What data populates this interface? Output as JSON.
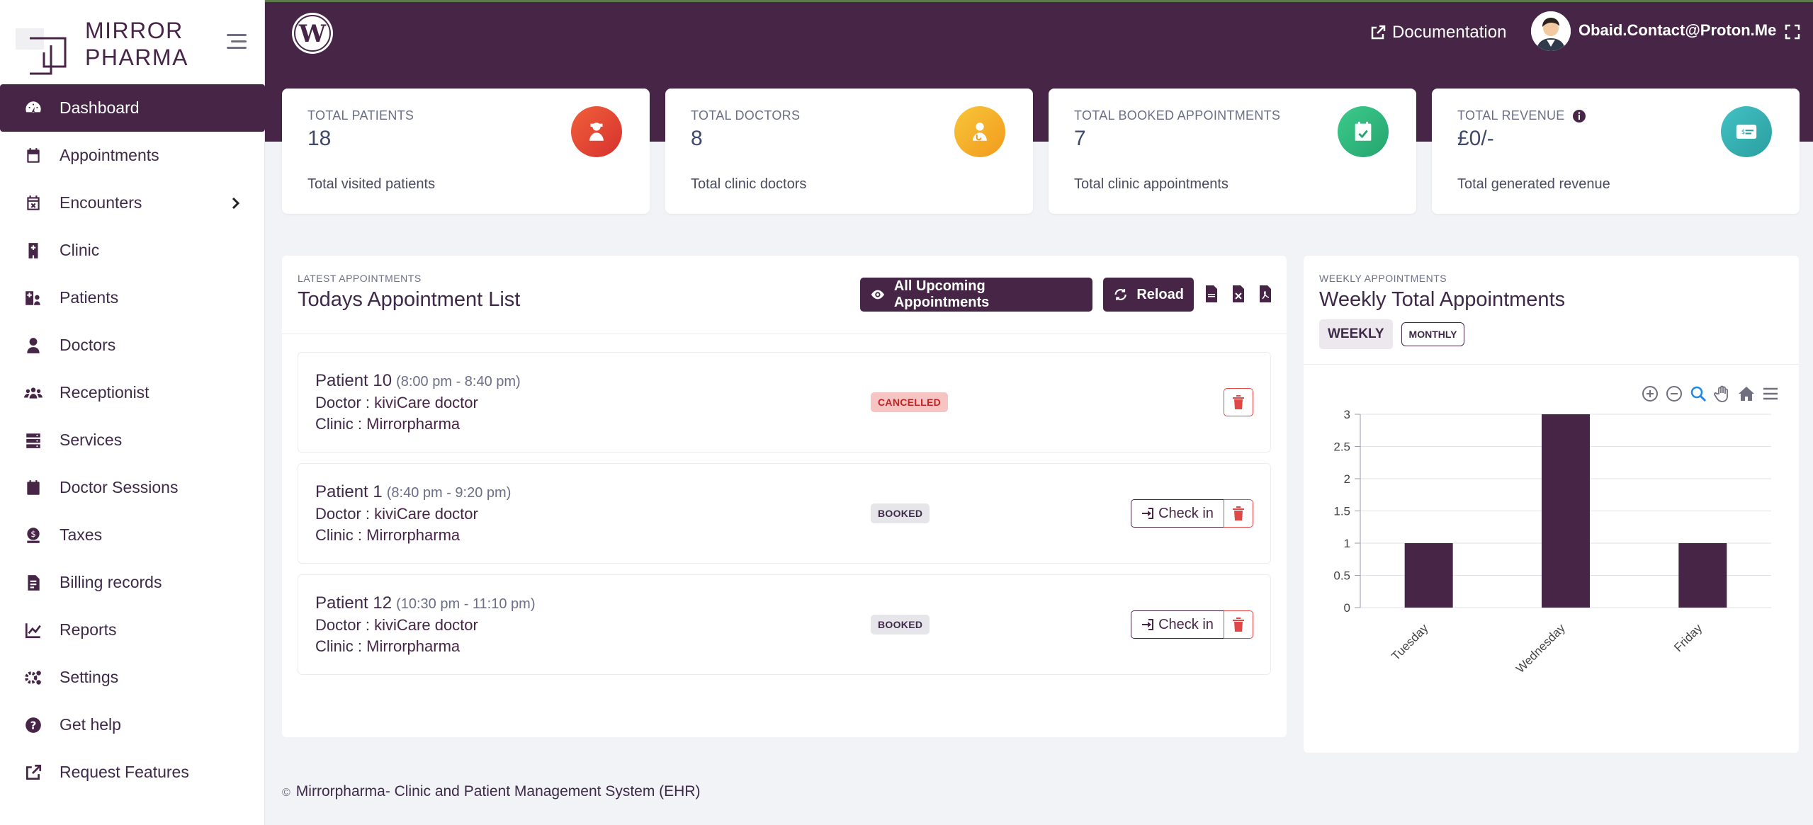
{
  "brand": {
    "name_line1": "MIRROR",
    "name_line2": "PHARMA"
  },
  "sidebar": {
    "items": [
      {
        "label": "Dashboard",
        "icon": "tachometer-icon",
        "active": true
      },
      {
        "label": "Appointments",
        "icon": "calendar-icon"
      },
      {
        "label": "Encounters",
        "icon": "calendar-x-icon",
        "has_submenu": true
      },
      {
        "label": "Clinic",
        "icon": "hospital-icon"
      },
      {
        "label": "Patients",
        "icon": "hospital-user-icon"
      },
      {
        "label": "Doctors",
        "icon": "user-md-icon"
      },
      {
        "label": "Receptionist",
        "icon": "users-icon"
      },
      {
        "label": "Services",
        "icon": "server-icon"
      },
      {
        "label": "Doctor Sessions",
        "icon": "calendar-icon"
      },
      {
        "label": "Taxes",
        "icon": "money-icon"
      },
      {
        "label": "Billing records",
        "icon": "file-invoice-icon"
      },
      {
        "label": "Reports",
        "icon": "chart-line-icon"
      },
      {
        "label": "Settings",
        "icon": "cogs-icon"
      },
      {
        "label": "Get help",
        "icon": "question-circle-icon"
      },
      {
        "label": "Request Features",
        "icon": "external-link-icon"
      }
    ]
  },
  "header": {
    "documentation_label": "Documentation",
    "user_name": "Obaid.Contact@Proton.Me"
  },
  "stats": [
    {
      "title": "TOTAL PATIENTS",
      "value": "18",
      "subtitle": "Total visited patients",
      "icon": "patient-icon",
      "color": "#e8452c"
    },
    {
      "title": "TOTAL DOCTORS",
      "value": "8",
      "subtitle": "Total clinic doctors",
      "icon": "doctor-icon",
      "color": "#f5a623"
    },
    {
      "title": "TOTAL BOOKED APPOINTMENTS",
      "value": "7",
      "subtitle": "Total clinic appointments",
      "icon": "calendar-check-icon",
      "color": "#2fb47d"
    },
    {
      "title": "TOTAL REVENUE",
      "value": "£0/-",
      "subtitle": "Total generated revenue",
      "icon": "money-check-icon",
      "color": "#2aa6a8"
    }
  ],
  "appointments_panel": {
    "kicker": "LATEST APPOINTMENTS",
    "title": "Todays Appointment List",
    "btn_all_upcoming": "All Upcoming Appointments",
    "btn_reload": "Reload",
    "checkin_label": "Check in",
    "doctor_prefix": "Doctor : ",
    "clinic_prefix": "Clinic : ",
    "rows": [
      {
        "patient": "Patient 10",
        "time": "(8:00 pm - 8:40 pm)",
        "doctor": "kiviCare doctor",
        "clinic": "Mirrorpharma",
        "status": "CANCELLED"
      },
      {
        "patient": "Patient 1",
        "time": "(8:40 pm - 9:20 pm)",
        "doctor": "kiviCare doctor",
        "clinic": "Mirrorpharma",
        "status": "BOOKED"
      },
      {
        "patient": "Patient 12",
        "time": "(10:30 pm - 11:10 pm)",
        "doctor": "kiviCare doctor",
        "clinic": "Mirrorpharma",
        "status": "BOOKED"
      }
    ]
  },
  "weekly_panel": {
    "kicker": "WEEKLY APPOINTMENTS",
    "title": "Weekly Total Appointments",
    "tab_weekly": "WEEKLY",
    "tab_monthly": "MONTHLY"
  },
  "chart_data": {
    "type": "bar",
    "categories": [
      "Tuesday",
      "Wednesday",
      "Friday"
    ],
    "values": [
      1,
      3,
      1
    ],
    "ylim": [
      0,
      3
    ],
    "yticks": [
      "3",
      "2.5",
      "2",
      "1.5",
      "1",
      "0.5",
      "0"
    ],
    "grid": true,
    "bar_color": "#472547"
  },
  "footer": {
    "copyright": "©",
    "text": "Mirrorpharma- Clinic and Patient Management System (EHR)"
  }
}
